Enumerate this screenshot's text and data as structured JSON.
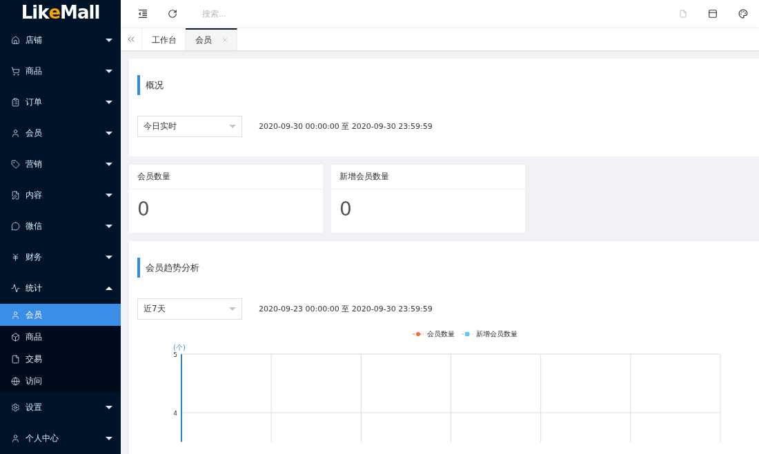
{
  "logo": {
    "text_start": "Lik",
    "text_accent": "e",
    "text_end": "Mall"
  },
  "sidebar": {
    "items": [
      {
        "label": "店铺",
        "expanded": false
      },
      {
        "label": "商品",
        "expanded": false
      },
      {
        "label": "订单",
        "expanded": false
      },
      {
        "label": "会员",
        "expanded": false
      },
      {
        "label": "营销",
        "expanded": false
      },
      {
        "label": "内容",
        "expanded": false
      },
      {
        "label": "微信",
        "expanded": false
      },
      {
        "label": "财务",
        "expanded": false
      },
      {
        "label": "统计",
        "expanded": true,
        "children": [
          {
            "label": "会员",
            "selected": true
          },
          {
            "label": "商品",
            "selected": false
          },
          {
            "label": "交易",
            "selected": false
          },
          {
            "label": "访问",
            "selected": false
          }
        ]
      },
      {
        "label": "设置",
        "expanded": false
      },
      {
        "label": "个人中心",
        "expanded": false
      }
    ]
  },
  "header": {
    "search": {
      "placeholder": "搜索..."
    }
  },
  "tabs": [
    {
      "label": "工作台",
      "selected": false,
      "closable": false
    },
    {
      "label": "会员",
      "selected": true,
      "closable": true
    }
  ],
  "overview": {
    "title": "概况",
    "period": "今日实时",
    "range": "2020-09-30 00:00:00 至 2020-09-30 23:59:59"
  },
  "stats": [
    {
      "label": "会员数量",
      "value": "0"
    },
    {
      "label": "新增会员数量",
      "value": "0"
    }
  ],
  "trend": {
    "title": "会员趋势分析",
    "period": "近7天",
    "range": "2020-09-23 00:00:00 至 2020-09-30 23:59:59",
    "chart_data": {
      "type": "line",
      "ylabel": "(个)",
      "ylim": [
        3.5,
        5
      ],
      "yticks": [
        4,
        5
      ],
      "series": [
        {
          "name": "会员数量",
          "color": "#f26b3a"
        },
        {
          "name": "新增会员数量",
          "color": "#5ac8fa"
        }
      ]
    }
  }
}
